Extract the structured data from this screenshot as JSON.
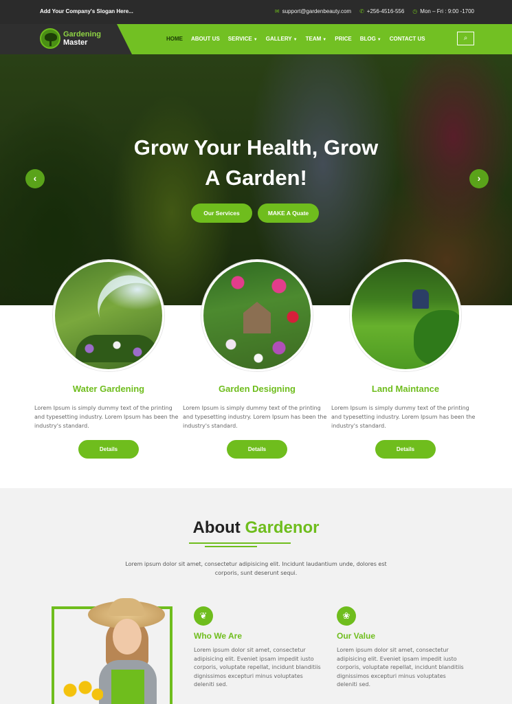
{
  "topbar": {
    "slogan": "Add Your Company's Slogan Here...",
    "email": "support@gardenbeauty.com",
    "phone": "+256-4516-556",
    "hours": "Mon – Fri : 9:00 -1700"
  },
  "logo": {
    "line1": "Gardening",
    "line2": "Master"
  },
  "nav": {
    "items": [
      {
        "label": "HOME"
      },
      {
        "label": "ABOUT US"
      },
      {
        "label": "SERVICE"
      },
      {
        "label": "GALLERY"
      },
      {
        "label": "TEAM"
      },
      {
        "label": "PRICE"
      },
      {
        "label": "BLOG"
      },
      {
        "label": "CONTACT US"
      }
    ]
  },
  "hero": {
    "title_line1": "Grow Your Health, Grow",
    "title_line2": "A Garden!",
    "btn1": "Our Services",
    "btn2": "MAKE A Quate",
    "prev": "‹",
    "next": "›"
  },
  "services": [
    {
      "title": "Water Gardening",
      "text": "Lorem Ipsum is simply dummy text of the printing and typesetting industry. Lorem Ipsum has been the industry's standard.",
      "btn": "Details"
    },
    {
      "title": "Garden Designing",
      "text": "Lorem Ipsum is simply dummy text of the printing and typesetting industry. Lorem Ipsum has been the industry's standard.",
      "btn": "Details"
    },
    {
      "title": "Land Maintance",
      "text": "Lorem Ipsum is simply dummy text of the printing and typesetting industry. Lorem Ipsum has been the industry's standard.",
      "btn": "Details"
    }
  ],
  "about": {
    "title_a": "About",
    "title_b": "Gardenor",
    "subtitle": "Lorem ipsum dolor sit amet, consectetur adipisicing elit. Incidunt laudantium unde, dolores est corporis, sunt deserunt sequi.",
    "features": [
      {
        "icon": "leaf-icon",
        "title": "Who We Are",
        "text": "Lorem ipsum dolor sit amet, consectetur adipisicing elit. Eveniet ipsam impedit iusto corporis, voluptate repellat, incidunt blanditiis dignissimos excepturi minus voluptates deleniti sed."
      },
      {
        "icon": "value-icon",
        "title": "Our Value",
        "text": "Lorem ipsum dolor sit amet, consectetur adipisicing elit. Eveniet ipsam impedit iusto corporis, voluptate repellat, incidunt blanditiis dignissimos excepturi minus voluptates deleniti sed."
      }
    ]
  },
  "colors": {
    "accent": "#6fbd1d",
    "dark": "#2b2b2b"
  }
}
